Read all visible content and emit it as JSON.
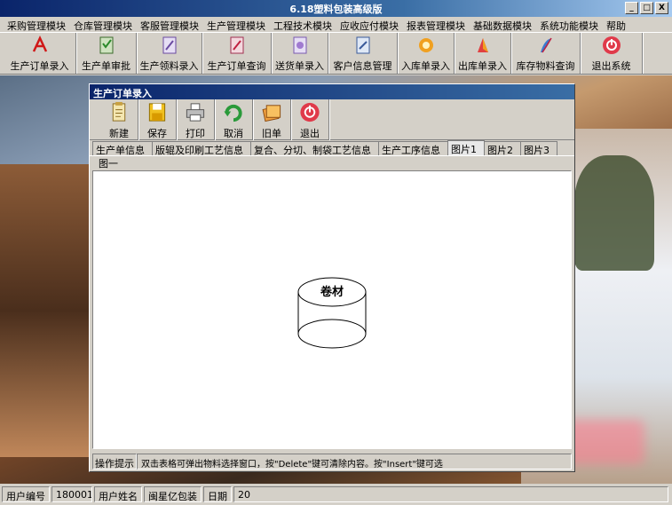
{
  "app": {
    "title": "6.18塑料包装高级版",
    "min_glyph": "_",
    "max_glyph": "□",
    "close_glyph": "X"
  },
  "menu": [
    "采购管理模块",
    "仓库管理模块",
    "客服管理模块",
    "生产管理模块",
    "工程技术模块",
    "应收应付模块",
    "报表管理模块",
    "基础数据模块",
    "系统功能模块",
    "帮助"
  ],
  "toolbar": [
    {
      "label": "生产订单录入",
      "icon": "pdf-icon"
    },
    {
      "label": "生产单审批",
      "icon": "approve-icon"
    },
    {
      "label": "生产领料录入",
      "icon": "pick-material-icon"
    },
    {
      "label": "生产订单查询",
      "icon": "order-query-icon"
    },
    {
      "label": "送货单录入",
      "icon": "delivery-icon"
    },
    {
      "label": "客户信息管理",
      "icon": "customer-icon"
    },
    {
      "label": "入库单录入",
      "icon": "inbound-icon"
    },
    {
      "label": "出库单录入",
      "icon": "outbound-icon"
    },
    {
      "label": "库存物料查询",
      "icon": "inventory-icon"
    },
    {
      "label": "退出系统",
      "icon": "exit-icon"
    }
  ],
  "child": {
    "title": "生产订单录入",
    "toolbar": [
      {
        "label": "新建",
        "icon": "new-icon"
      },
      {
        "label": "保存",
        "icon": "save-icon"
      },
      {
        "label": "打印",
        "icon": "print-icon"
      },
      {
        "label": "取消",
        "icon": "cancel-icon"
      },
      {
        "label": "旧单",
        "icon": "old-order-icon"
      },
      {
        "label": "退出",
        "icon": "exit-icon"
      }
    ],
    "tabs": [
      "生产单信息",
      "版辊及印刷工艺信息",
      "复合、分切、制袋工艺信息",
      "生产工序信息",
      "图片1",
      "图片2",
      "图片3"
    ],
    "active_tab": 4,
    "subtab": "图一",
    "drawing_label": "卷材",
    "hint_label": "操作提示",
    "hint_text": "双击表格可弹出物料选择窗口，按\"Delete\"键可清除内容。按\"Insert\"键可选"
  },
  "statusbar": {
    "user_id_label": "用户编号",
    "user_id": "180001",
    "user_name_label": "用户姓名",
    "user_name": "闽星亿包装",
    "date_label": "日期",
    "date_partial": "20"
  },
  "colors": {
    "titlebar": "#0a246a",
    "face": "#d4d0c8"
  }
}
